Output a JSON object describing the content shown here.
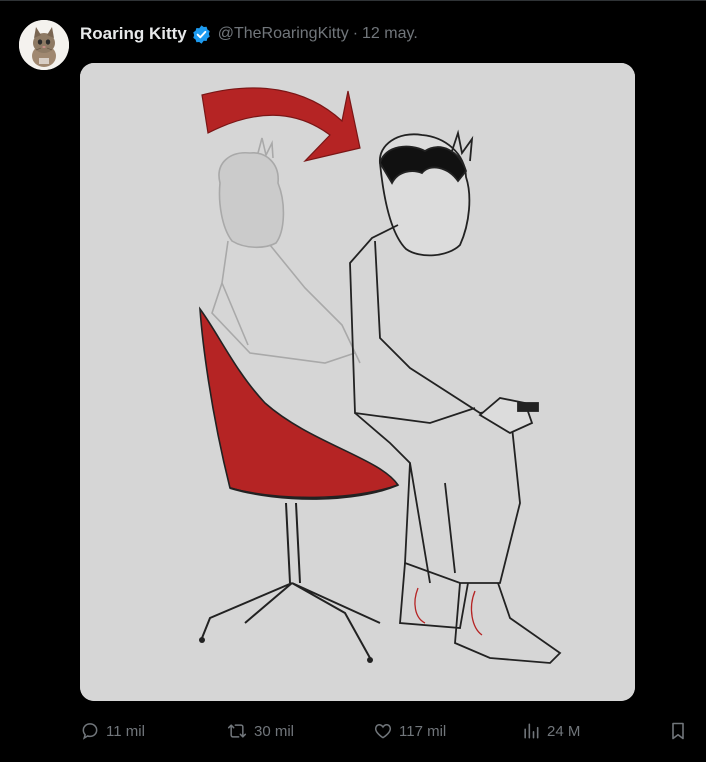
{
  "tweet": {
    "author": {
      "display_name": "Roaring Kitty",
      "handle": "@TheRoaringKitty",
      "verified": true,
      "verified_color": "#1d9bf0",
      "avatar_icon": "kitten-avatar"
    },
    "separator": "·",
    "date": "12 may.",
    "media": {
      "background": "#d6d6d6",
      "accent_color": "#b52424"
    },
    "actions": {
      "replies": "11 mil",
      "retweets": "30 mil",
      "likes": "117 mil",
      "views": "24 M"
    }
  },
  "colors": {
    "background": "#000000",
    "text_primary": "#e7e9ea",
    "text_secondary": "#71767b"
  }
}
